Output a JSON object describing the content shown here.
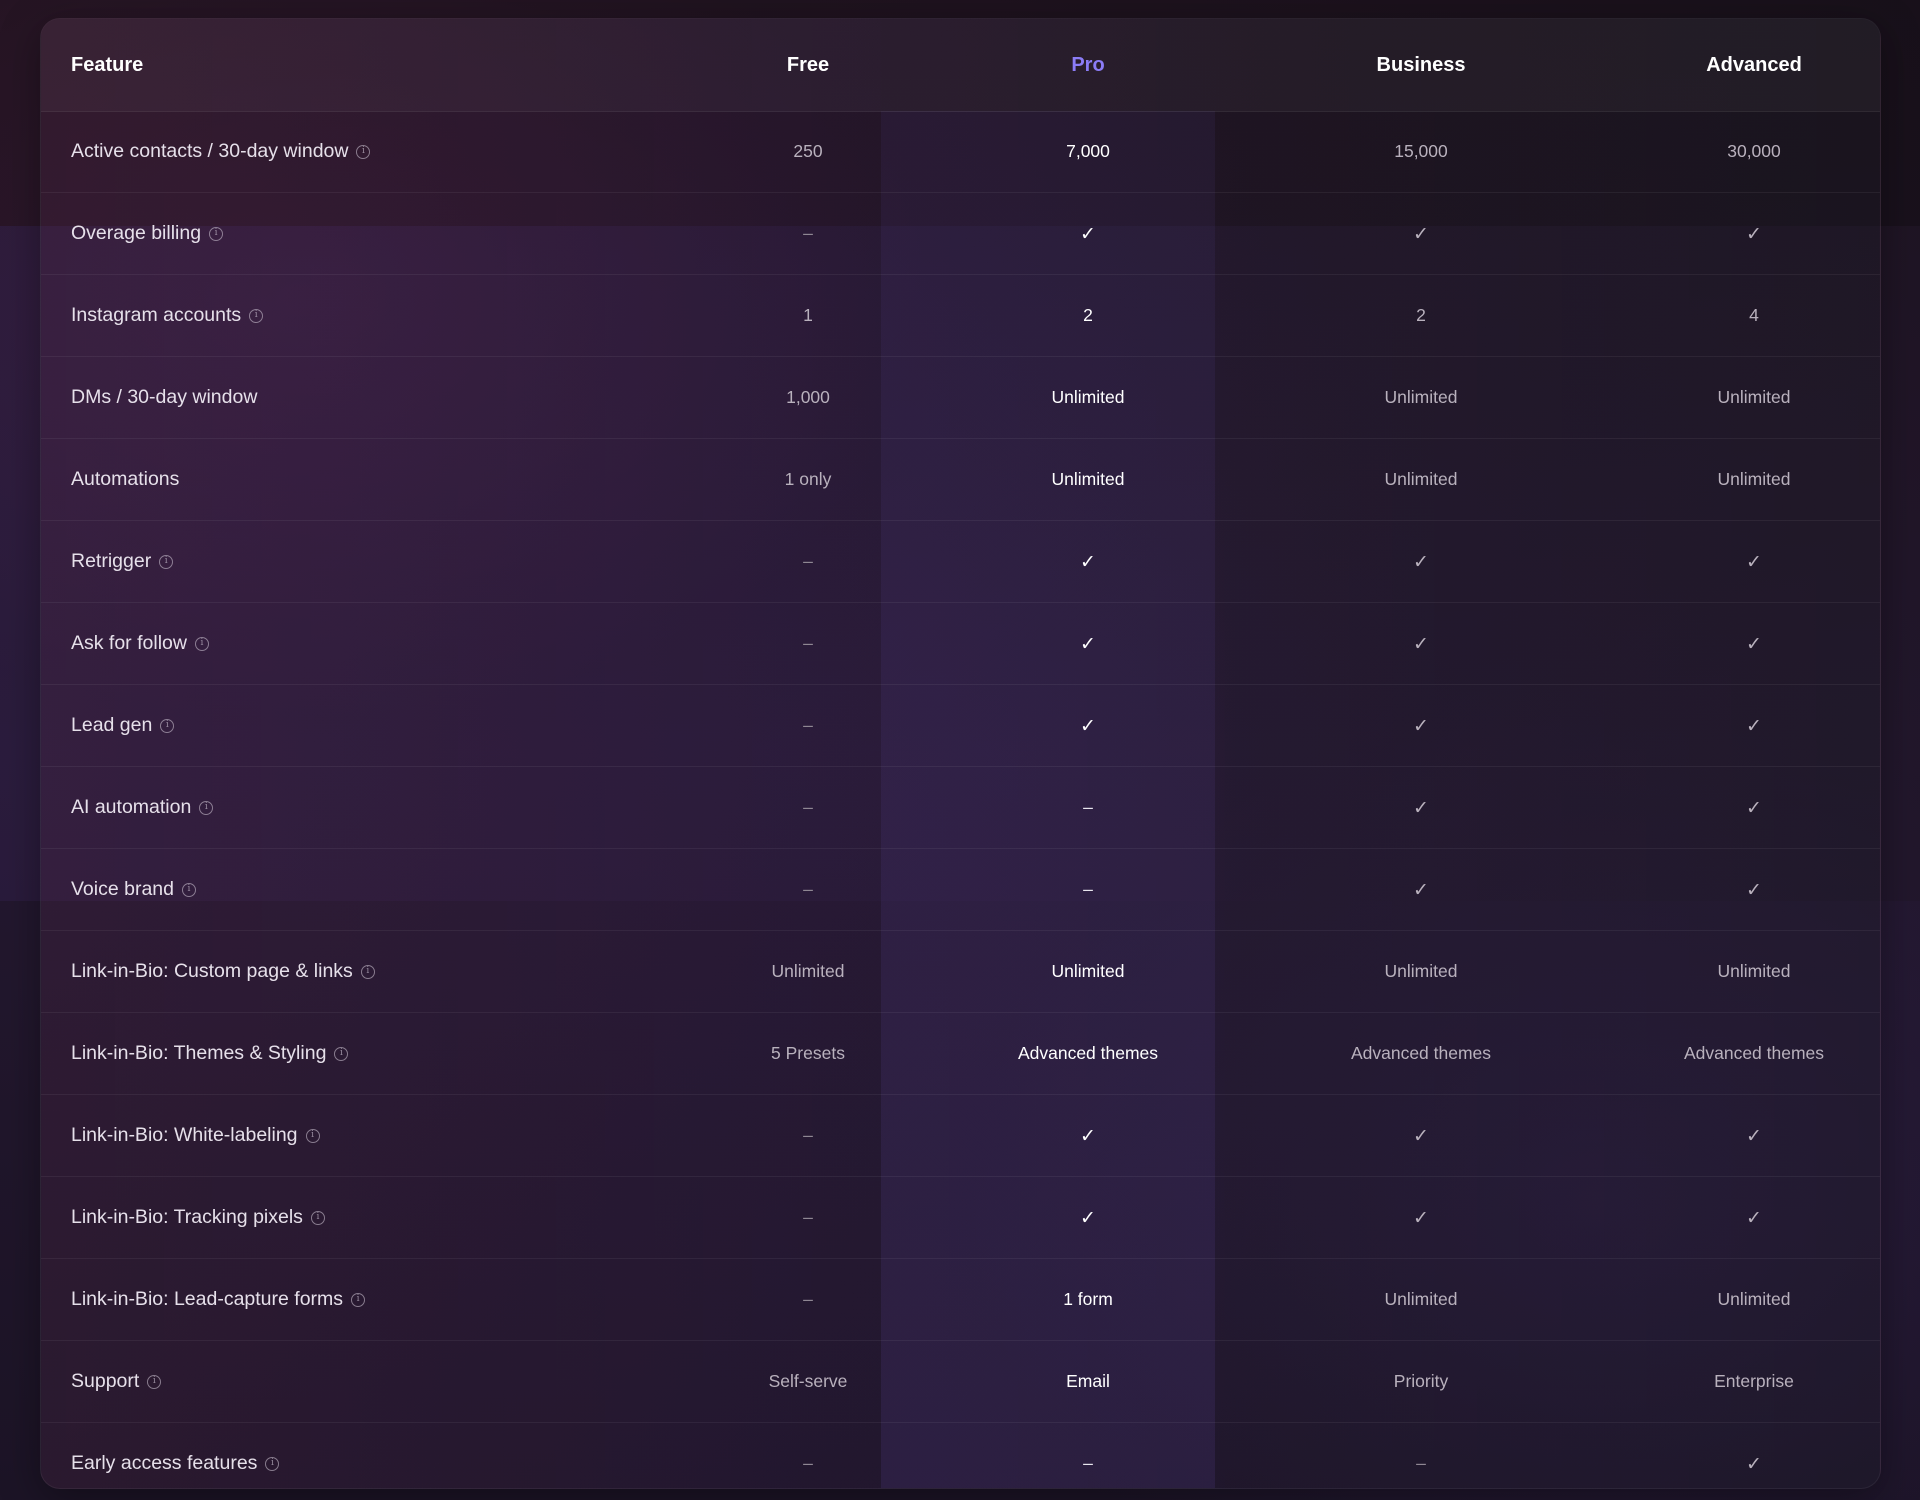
{
  "table": {
    "headers": {
      "feature": "Feature",
      "free": "Free",
      "pro": "Pro",
      "business": "Business",
      "advanced": "Advanced"
    },
    "rows": [
      {
        "feature": "Active contacts / 30-day window",
        "info": true,
        "free": "250",
        "pro": "7,000",
        "business": "15,000",
        "advanced": "30,000"
      },
      {
        "feature": "Overage billing",
        "info": true,
        "free": "–",
        "pro": "✓",
        "business": "✓",
        "advanced": "✓"
      },
      {
        "feature": "Instagram accounts",
        "info": true,
        "free": "1",
        "pro": "2",
        "business": "2",
        "advanced": "4"
      },
      {
        "feature": "DMs / 30-day window",
        "info": false,
        "free": "1,000",
        "pro": "Unlimited",
        "business": "Unlimited",
        "advanced": "Unlimited"
      },
      {
        "feature": "Automations",
        "info": false,
        "free": "1 only",
        "pro": "Unlimited",
        "business": "Unlimited",
        "advanced": "Unlimited"
      },
      {
        "feature": "Retrigger",
        "info": true,
        "free": "–",
        "pro": "✓",
        "business": "✓",
        "advanced": "✓"
      },
      {
        "feature": "Ask for follow",
        "info": true,
        "free": "–",
        "pro": "✓",
        "business": "✓",
        "advanced": "✓"
      },
      {
        "feature": "Lead gen",
        "info": true,
        "free": "–",
        "pro": "✓",
        "business": "✓",
        "advanced": "✓"
      },
      {
        "feature": "AI automation",
        "info": true,
        "free": "–",
        "pro": "–",
        "business": "✓",
        "advanced": "✓"
      },
      {
        "feature": "Voice brand",
        "info": true,
        "free": "–",
        "pro": "–",
        "business": "✓",
        "advanced": "✓"
      },
      {
        "feature": "Link-in-Bio: Custom page & links",
        "info": true,
        "free": "Unlimited",
        "pro": "Unlimited",
        "business": "Unlimited",
        "advanced": "Unlimited"
      },
      {
        "feature": "Link-in-Bio: Themes & Styling",
        "info": true,
        "free": "5 Presets",
        "pro": "Advanced themes",
        "business": "Advanced themes",
        "advanced": "Advanced themes"
      },
      {
        "feature": "Link-in-Bio: White-labeling",
        "info": true,
        "free": "–",
        "pro": "✓",
        "business": "✓",
        "advanced": "✓"
      },
      {
        "feature": "Link-in-Bio: Tracking pixels",
        "info": true,
        "free": "–",
        "pro": "✓",
        "business": "✓",
        "advanced": "✓"
      },
      {
        "feature": "Link-in-Bio: Lead-capture forms",
        "info": true,
        "free": "–",
        "pro": "1 form",
        "business": "Unlimited",
        "advanced": "Unlimited"
      },
      {
        "feature": "Support",
        "info": true,
        "free": "Self-serve",
        "pro": "Email",
        "business": "Priority",
        "advanced": "Enterprise"
      },
      {
        "feature": "Early access features",
        "info": true,
        "free": "–",
        "pro": "–",
        "business": "–",
        "advanced": "✓"
      }
    ]
  },
  "icons": {
    "info": "info-icon",
    "check": "check-icon",
    "dash": "dash-icon"
  },
  "colors": {
    "pro_accent": "#8b7cf6",
    "header_text": "#ffffff",
    "cell_text": "#b9b1bd"
  }
}
